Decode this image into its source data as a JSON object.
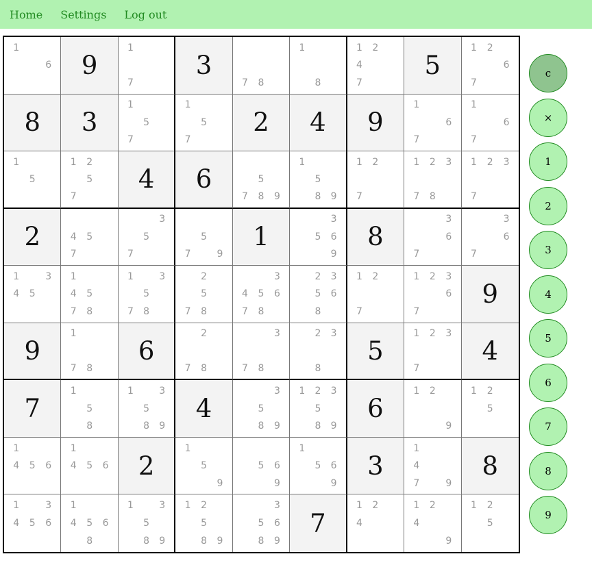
{
  "nav": {
    "items": [
      "Home",
      "Settings",
      "Log out"
    ]
  },
  "colors": {
    "nav_bg": "#b1f2b1",
    "nav_text": "#228b22",
    "given_cell_bg": "#f3f3f3",
    "pad_bg": "#b1f2b1",
    "pad_active_bg": "#8fc48f"
  },
  "board": {
    "cells": [
      [
        {
          "n": [
            1,
            6
          ]
        },
        {
          "v": 9
        },
        {
          "n": [
            1,
            7
          ]
        },
        {
          "v": 3
        },
        {
          "n": [
            7,
            8
          ]
        },
        {
          "n": [
            1,
            8
          ]
        },
        {
          "n": [
            1,
            2,
            4,
            7
          ]
        },
        {
          "v": 5
        },
        {
          "n": [
            1,
            2,
            6,
            7
          ]
        }
      ],
      [
        {
          "v": 8
        },
        {
          "v": 3
        },
        {
          "n": [
            1,
            5,
            7
          ]
        },
        {
          "n": [
            1,
            5,
            7
          ]
        },
        {
          "v": 2
        },
        {
          "v": 4
        },
        {
          "v": 9
        },
        {
          "n": [
            1,
            6,
            7
          ]
        },
        {
          "n": [
            1,
            6,
            7
          ]
        }
      ],
      [
        {
          "n": [
            1,
            5
          ]
        },
        {
          "n": [
            1,
            2,
            5,
            7
          ]
        },
        {
          "v": 4
        },
        {
          "v": 6
        },
        {
          "n": [
            5,
            7,
            8,
            9
          ]
        },
        {
          "n": [
            1,
            5,
            8,
            9
          ]
        },
        {
          "n": [
            1,
            2,
            7
          ]
        },
        {
          "n": [
            1,
            2,
            3,
            7,
            8
          ]
        },
        {
          "n": [
            1,
            2,
            3,
            7
          ]
        }
      ],
      [
        {
          "v": 2
        },
        {
          "n": [
            4,
            5,
            7
          ]
        },
        {
          "n": [
            3,
            5,
            7
          ]
        },
        {
          "n": [
            5,
            7,
            9
          ]
        },
        {
          "v": 1
        },
        {
          "n": [
            3,
            5,
            6,
            9
          ]
        },
        {
          "v": 8
        },
        {
          "n": [
            3,
            6,
            7
          ]
        },
        {
          "n": [
            3,
            6,
            7
          ]
        }
      ],
      [
        {
          "n": [
            1,
            3,
            4,
            5
          ]
        },
        {
          "n": [
            1,
            4,
            5,
            7,
            8
          ]
        },
        {
          "n": [
            1,
            3,
            5,
            7,
            8
          ]
        },
        {
          "n": [
            2,
            5,
            7,
            8
          ]
        },
        {
          "n": [
            3,
            4,
            5,
            6,
            7,
            8
          ]
        },
        {
          "n": [
            2,
            3,
            5,
            6,
            8
          ]
        },
        {
          "n": [
            1,
            2,
            7
          ]
        },
        {
          "n": [
            1,
            2,
            3,
            6,
            7
          ]
        },
        {
          "v": 9
        }
      ],
      [
        {
          "v": 9
        },
        {
          "n": [
            1,
            7,
            8
          ]
        },
        {
          "v": 6
        },
        {
          "n": [
            2,
            7,
            8
          ]
        },
        {
          "n": [
            3,
            7,
            8
          ]
        },
        {
          "n": [
            2,
            3,
            8
          ]
        },
        {
          "v": 5
        },
        {
          "n": [
            1,
            2,
            3,
            7
          ]
        },
        {
          "v": 4
        }
      ],
      [
        {
          "v": 7
        },
        {
          "n": [
            1,
            5,
            8
          ]
        },
        {
          "n": [
            1,
            3,
            5,
            8,
            9
          ]
        },
        {
          "v": 4
        },
        {
          "n": [
            3,
            5,
            8,
            9
          ]
        },
        {
          "n": [
            1,
            2,
            3,
            5,
            8,
            9
          ]
        },
        {
          "v": 6
        },
        {
          "n": [
            1,
            2,
            9
          ]
        },
        {
          "n": [
            1,
            2,
            5
          ]
        }
      ],
      [
        {
          "n": [
            1,
            4,
            5,
            6
          ]
        },
        {
          "n": [
            1,
            4,
            5,
            6
          ]
        },
        {
          "v": 2
        },
        {
          "n": [
            1,
            5,
            9
          ]
        },
        {
          "n": [
            5,
            6,
            9
          ]
        },
        {
          "n": [
            1,
            5,
            6,
            9
          ]
        },
        {
          "v": 3
        },
        {
          "n": [
            1,
            4,
            7,
            9
          ]
        },
        {
          "v": 8
        }
      ],
      [
        {
          "n": [
            1,
            3,
            4,
            5,
            6
          ]
        },
        {
          "n": [
            1,
            4,
            5,
            6,
            8
          ]
        },
        {
          "n": [
            1,
            3,
            5,
            8,
            9
          ]
        },
        {
          "n": [
            1,
            2,
            5,
            8,
            9
          ]
        },
        {
          "n": [
            3,
            5,
            6,
            8,
            9
          ]
        },
        {
          "v": 7
        },
        {
          "n": [
            1,
            2,
            4
          ]
        },
        {
          "n": [
            1,
            2,
            4,
            9
          ]
        },
        {
          "n": [
            1,
            2,
            5
          ]
        }
      ]
    ]
  },
  "pad": {
    "buttons": [
      {
        "label": "c",
        "name": "clear-mode-button",
        "active": true
      },
      {
        "label": "×",
        "name": "erase-button",
        "active": false
      },
      {
        "label": "1",
        "name": "digit-1-button",
        "active": false
      },
      {
        "label": "2",
        "name": "digit-2-button",
        "active": false
      },
      {
        "label": "3",
        "name": "digit-3-button",
        "active": false
      },
      {
        "label": "4",
        "name": "digit-4-button",
        "active": false
      },
      {
        "label": "5",
        "name": "digit-5-button",
        "active": false
      },
      {
        "label": "6",
        "name": "digit-6-button",
        "active": false
      },
      {
        "label": "7",
        "name": "digit-7-button",
        "active": false
      },
      {
        "label": "8",
        "name": "digit-8-button",
        "active": false
      },
      {
        "label": "9",
        "name": "digit-9-button",
        "active": false
      }
    ]
  }
}
